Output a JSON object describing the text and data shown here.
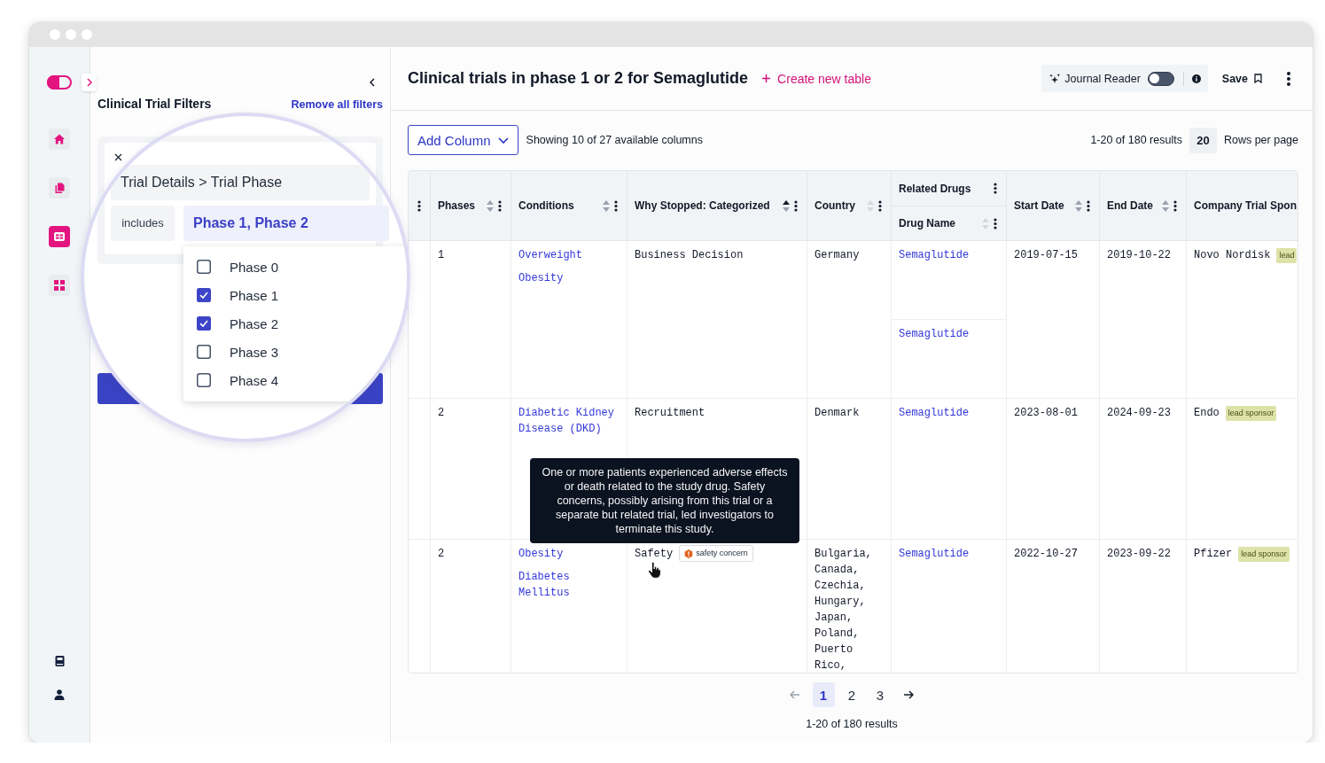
{
  "nav_items": [
    {
      "selected": false
    },
    {
      "selected": false
    },
    {
      "selected": true
    },
    {
      "selected": false
    }
  ],
  "filter_panel": {
    "title": "Clinical Trial Filters",
    "remove_all": "Remove all filters"
  },
  "magnifier": {
    "path": "Trial Details > Trial Phase",
    "operator": "includes",
    "value": "Phase 1, Phase 2",
    "options": [
      {
        "label": "Phase 0",
        "checked": false
      },
      {
        "label": "Phase 1",
        "checked": true
      },
      {
        "label": "Phase 2",
        "checked": true
      },
      {
        "label": "Phase 3",
        "checked": false
      },
      {
        "label": "Phase 4",
        "checked": false
      }
    ]
  },
  "header": {
    "title": "Clinical trials in phase 1 or 2 for Semaglutide",
    "create_link": "Create new table",
    "journal_reader": {
      "label": "Journal Reader",
      "on": false
    },
    "save": "Save"
  },
  "toolbar": {
    "add_column": "Add Column",
    "columns_info": "Showing 10 of 27 available columns",
    "results": "1-20 of 180 results",
    "rows_per_page": "20",
    "rows_per_page_label": "Rows per page"
  },
  "table": {
    "columns": [
      {
        "kind": "partial"
      },
      {
        "kind": "column",
        "label": "Phases",
        "sorted": false,
        "sort_disabled": false
      },
      {
        "kind": "column",
        "label": "Conditions",
        "sorted": false,
        "sort_disabled": false
      },
      {
        "kind": "column",
        "label": "Why Stopped: Categorized",
        "sorted": true,
        "sort_disabled": false
      },
      {
        "kind": "column",
        "label": "Country",
        "sorted": false,
        "sort_disabled": true
      },
      {
        "kind": "group",
        "label": "Related Drugs",
        "children": [
          {
            "label": "Drug Name",
            "sorted": false,
            "sort_disabled": true
          }
        ]
      },
      {
        "kind": "column",
        "label": "Start Date",
        "sorted": false,
        "sort_disabled": false
      },
      {
        "kind": "column",
        "label": "End Date",
        "sorted": false,
        "sort_disabled": false
      },
      {
        "kind": "cut",
        "label": "Company Trial Spon"
      }
    ],
    "rows": [
      {
        "phases": "1",
        "conditions": [
          "Overweight",
          "Obesity"
        ],
        "why_stopped": {
          "text": "Business Decision"
        },
        "country": "Germany",
        "drug_names": [
          "Semaglutide",
          "Semaglutide"
        ],
        "start_date": "2019-07-15",
        "end_date": "2019-10-22",
        "sponsor": {
          "name": "Novo Nordisk",
          "tag": "lead"
        }
      },
      {
        "phases": "2",
        "conditions": [
          "Diabetic Kidney Disease (DKD)"
        ],
        "why_stopped": {
          "text": "Recruitment"
        },
        "country": "Denmark",
        "drug_names": [
          "Semaglutide"
        ],
        "start_date": "2023-08-01",
        "end_date": "2024-09-23",
        "sponsor": {
          "name": "Endo",
          "tag": "lead sponsor"
        }
      },
      {
        "phases": "2",
        "conditions": [
          "Obesity",
          "Diabetes Mellitus"
        ],
        "why_stopped": {
          "text": "Safety",
          "tag": "safety concern"
        },
        "country": "Bulgaria, Canada, Czechia, Hungary, Japan, Poland, Puerto Rico,",
        "drug_names": [
          "Semaglutide"
        ],
        "start_date": "2022-10-27",
        "end_date": "2023-09-22",
        "sponsor": {
          "name": "Pfizer",
          "tag": "lead sponsor"
        }
      }
    ]
  },
  "tooltip": "One or more patients experienced adverse effects or death related to the study drug. Safety concerns, possibly arising from this trial or a separate but related trial, led investigators to terminate this study.",
  "pagination": {
    "previous_disabled": true,
    "pages": [
      {
        "label": "1",
        "selected": true
      },
      {
        "label": "2",
        "selected": false
      },
      {
        "label": "3",
        "selected": false
      }
    ],
    "next_disabled": false,
    "summary": "1-20 of 180 results"
  }
}
